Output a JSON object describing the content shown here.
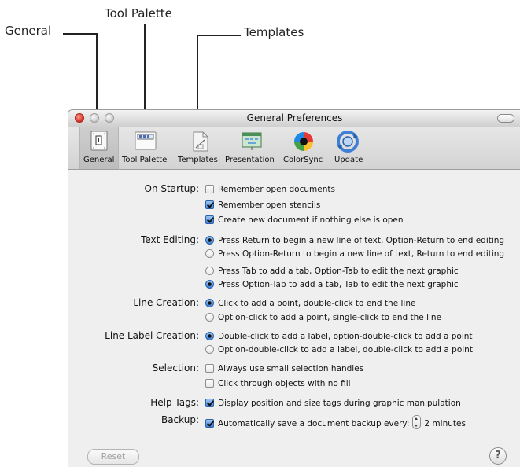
{
  "callouts": {
    "general": "General",
    "tool_palette": "Tool Palette",
    "templates": "Templates"
  },
  "window": {
    "title": "General Preferences"
  },
  "toolbar": {
    "items": [
      {
        "label": "General",
        "icon": "general-icon"
      },
      {
        "label": "Tool Palette",
        "icon": "tool-palette-icon"
      },
      {
        "label": "Templates",
        "icon": "templates-icon"
      },
      {
        "label": "Presentation",
        "icon": "presentation-icon"
      },
      {
        "label": "ColorSync",
        "icon": "colorsync-icon"
      },
      {
        "label": "Update",
        "icon": "update-icon"
      }
    ],
    "selected": "General"
  },
  "sections": {
    "on_startup": {
      "label": "On Startup:",
      "options": [
        {
          "text": "Remember open documents",
          "checked": false
        },
        {
          "text": "Remember open stencils",
          "checked": true
        },
        {
          "text": "Create new document if nothing else is open",
          "checked": true
        }
      ]
    },
    "text_editing": {
      "label": "Text Editing:",
      "options": [
        {
          "text": "Press Return to begin a new line of text, Option-Return to end editing",
          "checked": true
        },
        {
          "text": "Press Option-Return to begin a new line of text, Return to end editing",
          "checked": false
        },
        {
          "text": "Press Tab to add a tab, Option-Tab to edit the next graphic",
          "checked": false
        },
        {
          "text": "Press Option-Tab to add a tab, Tab to edit the next graphic",
          "checked": true
        }
      ]
    },
    "line_creation": {
      "label": "Line Creation:",
      "options": [
        {
          "text": "Click to add a point, double-click to end the line",
          "checked": true
        },
        {
          "text": "Option-click to add a point, single-click to end the line",
          "checked": false
        }
      ]
    },
    "line_label_creation": {
      "label": "Line Label Creation:",
      "options": [
        {
          "text": "Double-click to add a label, option-double-click to add a point",
          "checked": true
        },
        {
          "text": "Option-double-click to add a label, double-click to add a point",
          "checked": false
        }
      ]
    },
    "selection": {
      "label": "Selection:",
      "options": [
        {
          "text": "Always use small selection handles",
          "checked": false
        },
        {
          "text": "Click through objects with no fill",
          "checked": false
        }
      ]
    },
    "help_tags": {
      "label": "Help Tags:",
      "options": [
        {
          "text": "Display position and size tags during graphic manipulation",
          "checked": true
        }
      ]
    },
    "backup": {
      "label": "Backup:",
      "text": "Automatically save a document backup every:",
      "checked": true,
      "interval": "2 minutes"
    }
  },
  "buttons": {
    "reset": "Reset",
    "help": "?"
  }
}
